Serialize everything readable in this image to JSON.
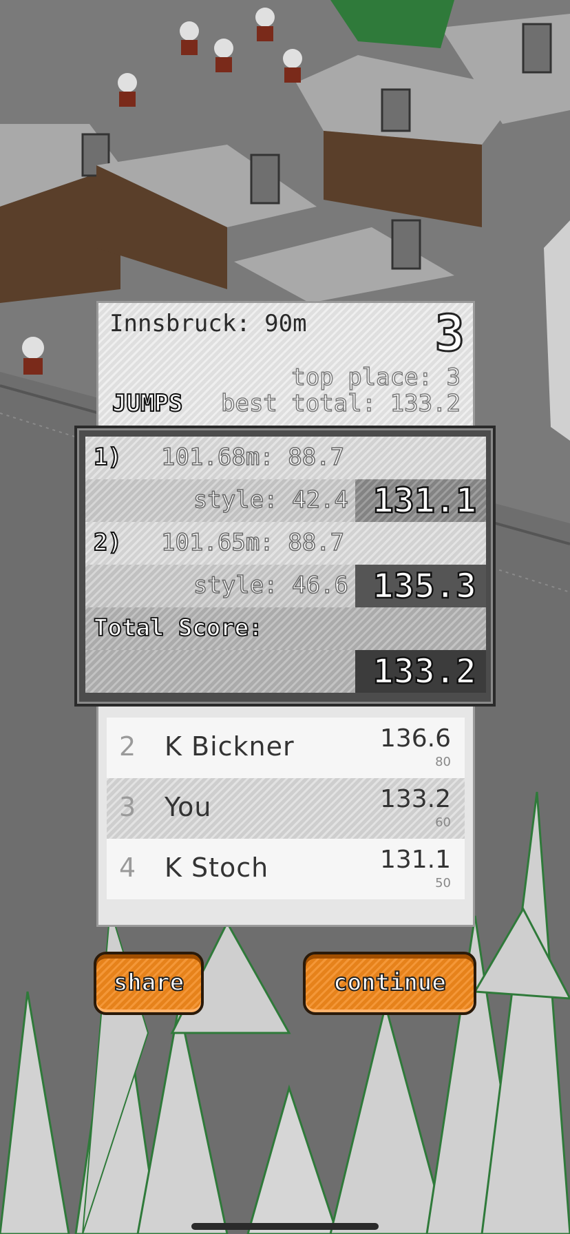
{
  "header": {
    "location": "Innsbruck: 90m",
    "place": "3",
    "top_place": "top place: 3",
    "best_total": "best total: 133.2",
    "jumps_label": "JUMPS"
  },
  "jumps": [
    {
      "num": "1)",
      "distance": "101.68m: 88.7",
      "style": "style: 42.4",
      "score": "131.1"
    },
    {
      "num": "2)",
      "distance": "101.65m: 88.7",
      "style": "style: 46.6",
      "score": "135.3"
    }
  ],
  "total": {
    "label": "Total Score:",
    "score": "133.2"
  },
  "ranking": [
    {
      "pos": "2",
      "name": "K Bickner",
      "score": "136.6",
      "points": "80"
    },
    {
      "pos": "3",
      "name": "You",
      "score": "133.2",
      "points": "60"
    },
    {
      "pos": "4",
      "name": "K Stoch",
      "score": "131.1",
      "points": "50"
    }
  ],
  "buttons": {
    "share": "share",
    "continue": "continue"
  },
  "colors": {
    "button": "#f2891c",
    "snow": "#d8d8d8",
    "tree": "#2f7a3a"
  }
}
